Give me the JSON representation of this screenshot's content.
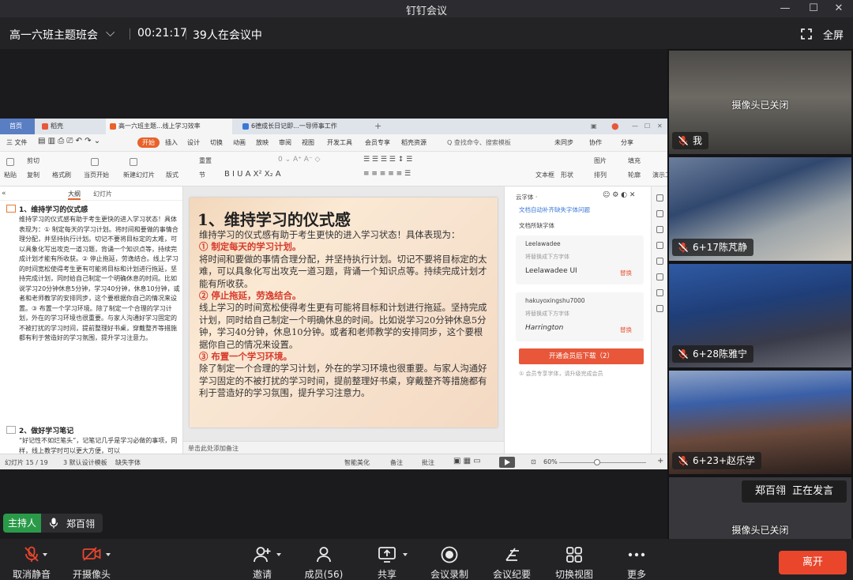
{
  "window": {
    "title": "钉钉会议"
  },
  "meeting": {
    "title": "高一六班主题班会",
    "elapsed": "00:21:17",
    "participants_text": "39人在会议中",
    "fullscreen_label": "全屏"
  },
  "wps": {
    "tabs": [
      "首页",
      "稻壳",
      "高一六班主题...线上学习效率",
      "6德成长日记即...一导师事工作"
    ],
    "menu": [
      "三 文件",
      "开始",
      "插入",
      "设计",
      "切换",
      "动画",
      "放映",
      "审阅",
      "视图",
      "开发工具",
      "会员专享",
      "稻壳资源",
      "Q 查找命令、搜索模板",
      "未同步",
      "协作",
      "分享"
    ],
    "ribbon": [
      "粘贴",
      "剪切",
      "复制",
      "格式刷",
      "当页开始",
      "新建幻灯片",
      "版式",
      "重置",
      "节",
      "文本框",
      "形状",
      "排列",
      "轮廓",
      "演示工具",
      "图片",
      "填充"
    ],
    "outline_tabs": [
      "大纲",
      "幻灯片"
    ],
    "outline": {
      "heading1": "1、维持学习的仪式感",
      "para1": "维持学习的仪式感有助于考生更快的进入学习状态！具体表现为：① 制定每天的学习计划。将时间和要做的事情合理分配，并坚持执行计划。切记不要将目标定的太难，可以具象化写出攻克一道习题，背诵一个知识点等，持续完成计划才能有所收获。② 停止拖延，劳逸结合。线上学习的时间宽松使得考生更有可能将目标和计划进行拖延，坚持完成计划，同时给自己制定一个明确休息的时间。比如说学习20分钟休息5分钟，学习40分钟，休息10分钟，或者和老师教学的安排同步，这个要根据你自己的情况来设置。③ 布置一个学习环境。除了制定一个合理的学习计划，外在的学习环境也很重要。与家人沟通好学习固定的不被打扰的学习时间，提前整理好书桌，穿戴整齐等措施都有利于营造好的学习氛围，提升学习注意力。",
      "heading2": "2、做好学习笔记",
      "para2": "“好记性不如烂笔头”，记笔记几乎是学习必做的事项，同样，线上教学时可以更大方便，可以"
    },
    "slide": {
      "title": "1、维持学习的仪式感",
      "intro": "维持学习的仪式感有助于考生更快的进入学习状态！具体表现为：",
      "p1_head": "① 制定每天的学习计划。",
      "p1": "将时间和要做的事情合理分配，并坚持执行计划。切记不要将目标定的太难，可以具象化写出攻克一道习题，背诵一个知识点等。持续完成计划才能有所收获。",
      "p2_head": "② 停止拖延，劳逸结合。",
      "p2": "线上学习的时间宽松使得考生更有可能将目标和计划进行拖延。坚持完成计划，同时给自己制定一个明确休息的时间。比如说学习20分钟休息5分钟，学习40分钟，休息10分钟。或者和老师教学的安排同步，这个要根据你自己的情况来设置。",
      "p3_head": "③ 布置一个学习环境。",
      "p3": "除了制定一个合理的学习计划，外在的学习环境也很重要。与家人沟通好学习固定的不被打扰的学习时间，提前整理好书桌，穿戴整齐等措施都有利于营造好的学习氛围，提升学习注意力。"
    },
    "notes": "单击此处添加备注",
    "fontpanel": {
      "title": "云字体 ·",
      "hint": "文档自动补齐缺失字体问题",
      "section": "文档所缺字体",
      "f1_name": "Leelawadee",
      "f1_sub": "将替换成下方字体",
      "f1_replace": "Leelawadee UI",
      "f1_action": "替换",
      "f2_name": "hakuyoxingshu7000",
      "f2_sub": "将替换成下方字体",
      "f2_replace": "Harrington",
      "f2_action": "替换",
      "download_btn": "开通会员后下载（2）",
      "tip": "① 会员专享字体，请升级完成会员"
    },
    "status": {
      "slide_no": "幻灯片 15 / 19",
      "template": "3 默认设计模板",
      "missing": "缺失字体",
      "beautify": "智能美化",
      "notes_btn": "备注",
      "comment_btn": "批注",
      "zoom": "60%"
    }
  },
  "host": {
    "tag": "主持人",
    "name": "郑百翎"
  },
  "tiles": [
    {
      "name": "我",
      "camera_off": "摄像头已关闭"
    },
    {
      "name": "6+17陈芃静"
    },
    {
      "name": "6+28陈雅宁"
    },
    {
      "name": "6+23+赵乐学"
    },
    {
      "camera_off": "摄像头已关闭"
    }
  ],
  "speaking": {
    "name": "郑百翎",
    "status": "正在发言"
  },
  "toolbar": {
    "unmute": "取消静音",
    "camera": "开摄像头",
    "invite": "邀请",
    "members": "成员(56)",
    "share": "共享",
    "record": "会议录制",
    "minutes": "会议纪要",
    "view": "切换视图",
    "more": "更多",
    "leave": "离开"
  },
  "colors": {
    "leave": "#e9462c",
    "host_tag": "#2a9a49",
    "mic_off": "#e9462c",
    "wps_start": "#e8622a"
  }
}
